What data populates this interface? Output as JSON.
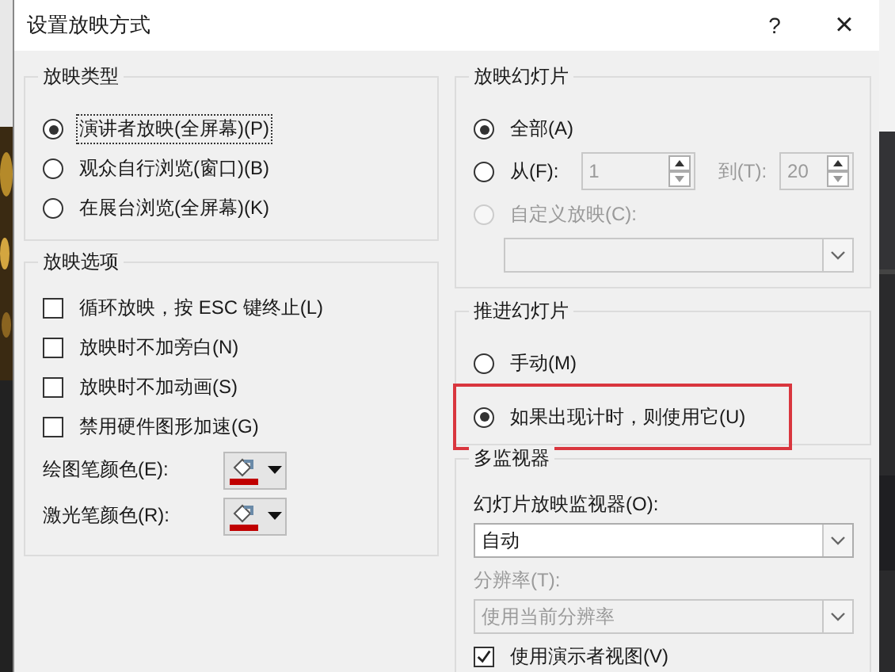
{
  "window": {
    "title": "设置放映方式",
    "help": "?",
    "close": "×"
  },
  "show_type": {
    "title": "放映类型",
    "options": [
      {
        "label": "演讲者放映(全屏幕)(P)",
        "selected": true,
        "focused": true
      },
      {
        "label": "观众自行浏览(窗口)(B)",
        "selected": false,
        "focused": false
      },
      {
        "label": "在展台浏览(全屏幕)(K)",
        "selected": false,
        "focused": false
      }
    ]
  },
  "show_options": {
    "title": "放映选项",
    "checkboxes": [
      {
        "label": "循环放映，按 ESC 键终止(L)",
        "checked": false
      },
      {
        "label": "放映时不加旁白(N)",
        "checked": false
      },
      {
        "label": "放映时不加动画(S)",
        "checked": false
      },
      {
        "label": "禁用硬件图形加速(G)",
        "checked": false
      }
    ],
    "pens": [
      {
        "label": "绘图笔颜色(E):"
      },
      {
        "label": "激光笔颜色(R):"
      }
    ]
  },
  "slides": {
    "title": "放映幻灯片",
    "options": [
      {
        "kind": "all",
        "label": "全部(A)",
        "selected": true,
        "disabled": false
      },
      {
        "kind": "range",
        "label": "从(F):",
        "selected": false,
        "disabled": false,
        "from": "1",
        "to_label": "到(T):",
        "to": "20"
      },
      {
        "kind": "custom",
        "label": "自定义放映(C):",
        "selected": false,
        "disabled": true
      }
    ]
  },
  "advance": {
    "title": "推进幻灯片",
    "options": [
      {
        "label": "手动(M)",
        "selected": false,
        "highlighted": false
      },
      {
        "label": "如果出现计时，则使用它(U)",
        "selected": true,
        "highlighted": true
      }
    ]
  },
  "monitors": {
    "title": "多监视器",
    "monitor_label": "幻灯片放映监视器(O):",
    "monitor_value": "自动",
    "resolution_label": "分辨率(T):",
    "resolution_value": "使用当前分辨率",
    "resolution_disabled": true,
    "presenter_view": {
      "label": "使用演示者视图(V)",
      "checked": true
    }
  }
}
